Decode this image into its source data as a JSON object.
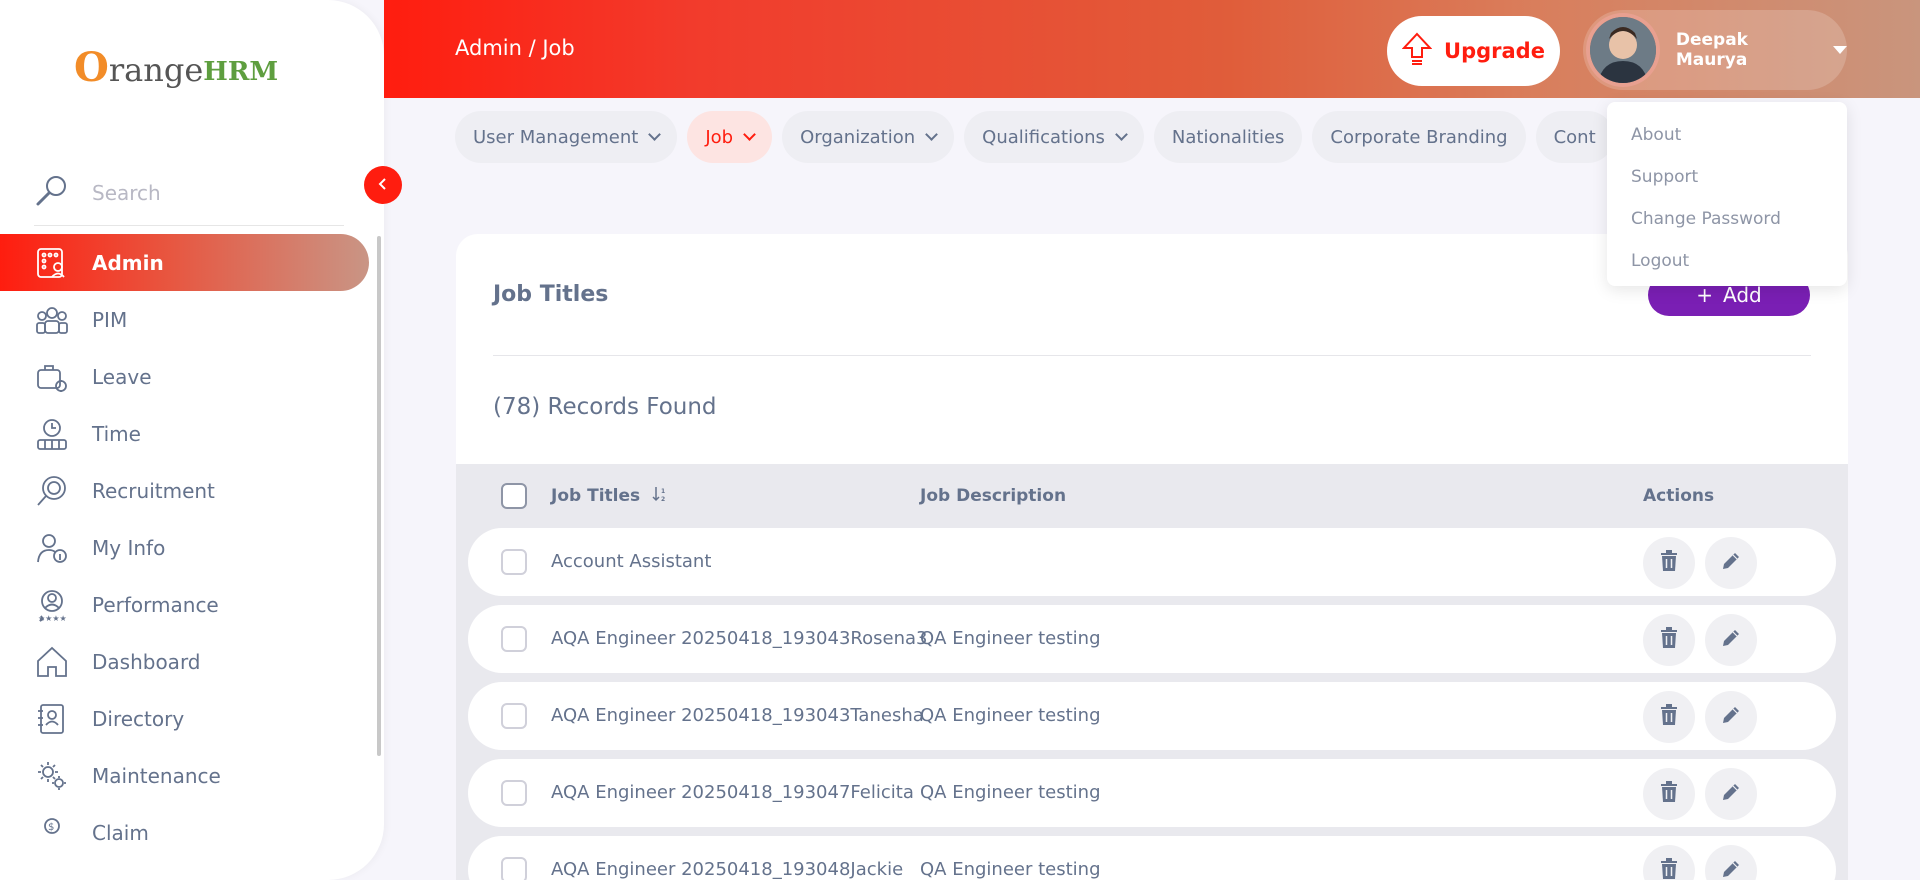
{
  "header": {
    "breadcrumb": "Admin / Job",
    "upgrade_label": "Upgrade",
    "user_name": "Deepak Maurya"
  },
  "user_menu": {
    "items": [
      "About",
      "Support",
      "Change Password",
      "Logout"
    ]
  },
  "sidebar": {
    "logo_o": "O",
    "logo_range": "range",
    "logo_hrm": "HRM",
    "search_placeholder": "Search",
    "items": [
      {
        "label": "Admin",
        "icon": "admin-icon",
        "active": true
      },
      {
        "label": "PIM",
        "icon": "pim-icon"
      },
      {
        "label": "Leave",
        "icon": "leave-icon"
      },
      {
        "label": "Time",
        "icon": "time-icon"
      },
      {
        "label": "Recruitment",
        "icon": "recruitment-icon"
      },
      {
        "label": "My Info",
        "icon": "my-info-icon"
      },
      {
        "label": "Performance",
        "icon": "performance-icon"
      },
      {
        "label": "Dashboard",
        "icon": "dashboard-icon"
      },
      {
        "label": "Directory",
        "icon": "directory-icon"
      },
      {
        "label": "Maintenance",
        "icon": "maintenance-icon"
      },
      {
        "label": "Claim",
        "icon": "claim-icon"
      }
    ]
  },
  "tabs": [
    {
      "label": "User Management",
      "dropdown": true
    },
    {
      "label": "Job",
      "dropdown": true,
      "active": true
    },
    {
      "label": "Organization",
      "dropdown": true
    },
    {
      "label": "Qualifications",
      "dropdown": true
    },
    {
      "label": "Nationalities"
    },
    {
      "label": "Corporate Branding"
    },
    {
      "label": "Cont"
    }
  ],
  "main": {
    "title": "Job Titles",
    "add_label": "Add",
    "records_found": "(78) Records Found",
    "columns": {
      "title": "Job Titles",
      "description": "Job Description",
      "actions": "Actions"
    },
    "rows": [
      {
        "title": "Account Assistant",
        "description": ""
      },
      {
        "title": "AQA Engineer 20250418_193043Rosena3",
        "description": "QA Engineer testing"
      },
      {
        "title": "AQA Engineer 20250418_193043Tanesha",
        "description": "QA Engineer testing"
      },
      {
        "title": "AQA Engineer 20250418_193047Felicita",
        "description": "QA Engineer testing"
      },
      {
        "title": "AQA Engineer 20250418_193048Jackie",
        "description": "QA Engineer testing"
      }
    ]
  },
  "colors": {
    "brand": "#ff1d0f",
    "accent_purple": "#7a1fb4",
    "text": "#64728c"
  }
}
